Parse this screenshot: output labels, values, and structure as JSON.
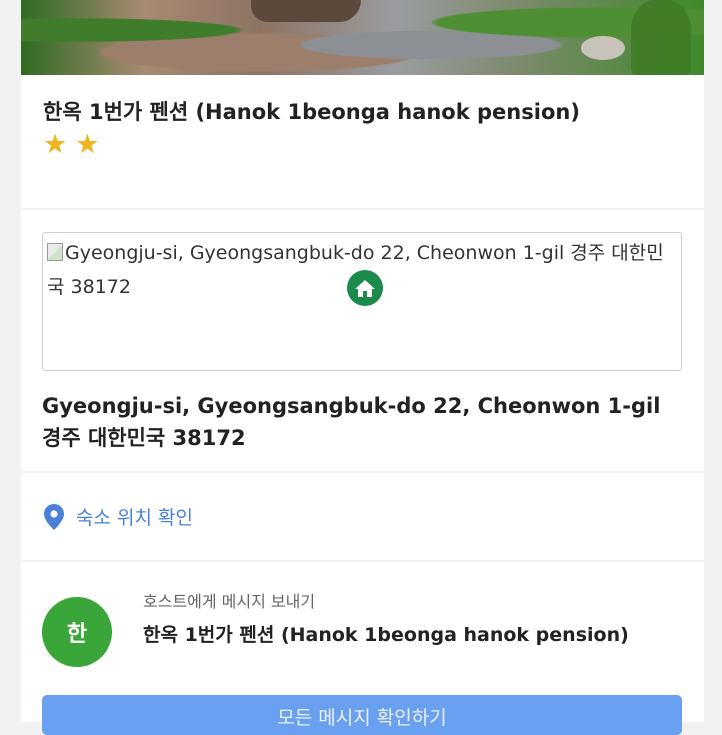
{
  "hero": {
    "image_alt": "garden photo"
  },
  "listing": {
    "title": "한옥 1번가 펜션 (Hanok 1beonga hanok pension)",
    "star_rating": 2,
    "star_glyph": "★",
    "star_color": "#f2b31c"
  },
  "address": {
    "map_alt_text": "Gyeongju-si, Gyeongsangbuk-do 22, Cheonwon 1-gil 경주 대한민국 38172",
    "full_address": "Gyeongju-si, Gyeongsangbuk-do 22, Cheonwon 1-gil 경주 대한민국 38172",
    "pin_icon": "home-map-pin-icon",
    "pin_color": "#1b8a4a"
  },
  "location": {
    "link_label": "숙소 위치 확인",
    "icon": "location-pin-icon",
    "link_color": "#4a80d8"
  },
  "host": {
    "message_label": "호스트에게 메시지 보내기",
    "name": "한옥 1번가 펜션 (Hanok 1beonga hanok pension)",
    "avatar_initial": "한",
    "avatar_color": "#3aa63a"
  },
  "actions": {
    "view_all_messages": "모든 메시지 확인하기"
  }
}
